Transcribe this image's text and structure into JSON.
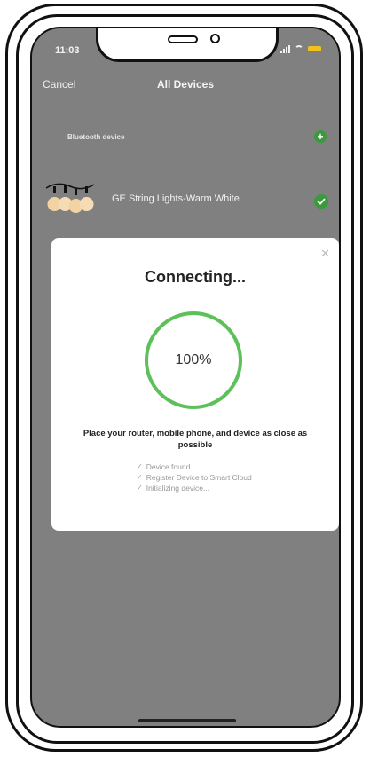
{
  "status_bar": {
    "time": "11:03"
  },
  "nav": {
    "cancel_label": "Cancel",
    "title": "All Devices"
  },
  "section": {
    "header": "Bluetooth device"
  },
  "device": {
    "name": "GE String Lights-Warm White"
  },
  "dialog": {
    "title": "Connecting...",
    "progress_text": "100%",
    "progress_fraction": 1.0,
    "hint": "Place your router, mobile phone, and device as close as possible",
    "steps": [
      "Device found",
      "Register Device to Smart Cloud",
      "Initializing device..."
    ]
  },
  "colors": {
    "screen_overlay": "#808080",
    "accent_green": "#3a9a3c",
    "ring_green": "#5dc15a",
    "battery": "#f0c21c"
  },
  "icons": {
    "close": "close-icon",
    "add": "add-icon",
    "check": "check-icon",
    "device_thumbnail": "string-lights-icon"
  }
}
